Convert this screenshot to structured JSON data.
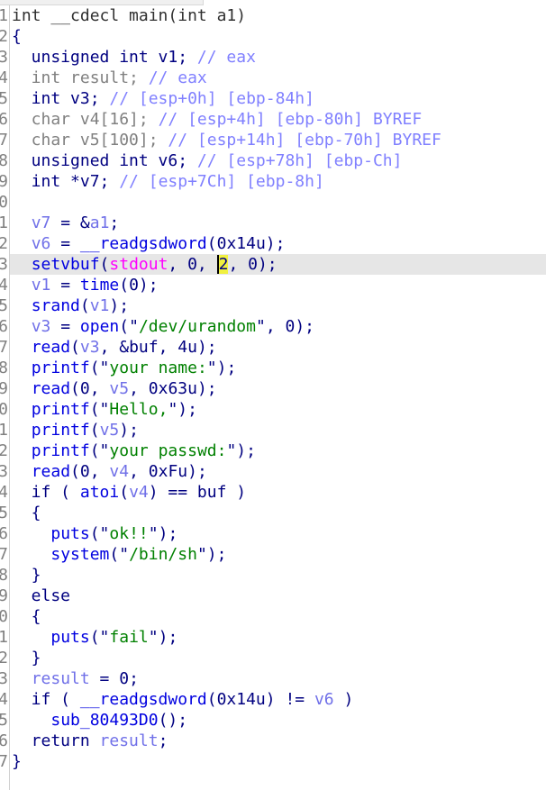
{
  "editor": {
    "view": "pseudocode",
    "current_line": 13,
    "colors": {
      "keyword": "#000080",
      "function": "#0000e0",
      "local_var": "#7070e8",
      "comment": "#8080ff",
      "unused": "#808080",
      "import": "#ff00ff",
      "string": "#008000",
      "highlight": "#f0f040"
    },
    "lines": [
      [
        [
          "hd",
          "int __cdecl main(int a1)"
        ]
      ],
      [
        [
          "kw",
          "{"
        ]
      ],
      [
        [
          "kw",
          "  unsigned int v1; "
        ],
        [
          "cm",
          "// eax"
        ]
      ],
      [
        [
          "un",
          "  int result; "
        ],
        [
          "cm",
          "// eax"
        ]
      ],
      [
        [
          "kw",
          "  int v3; "
        ],
        [
          "cm",
          "// [esp+0h] [ebp-84h]"
        ]
      ],
      [
        [
          "un",
          "  char v4[16]; "
        ],
        [
          "cm",
          "// [esp+4h] [ebp-80h] BYREF"
        ]
      ],
      [
        [
          "un",
          "  char v5[100]; "
        ],
        [
          "cm",
          "// [esp+14h] [ebp-70h] BYREF"
        ]
      ],
      [
        [
          "kw",
          "  unsigned int v6; "
        ],
        [
          "cm",
          "// [esp+78h] [ebp-Ch]"
        ]
      ],
      [
        [
          "kw",
          "  int *v7; "
        ],
        [
          "cm",
          "// [esp+7Ch] [ebp-8h]"
        ]
      ],
      [],
      [
        [
          "kw",
          "  "
        ],
        [
          "lv",
          "v7"
        ],
        [
          "kw",
          " = &"
        ],
        [
          "lv",
          "a1"
        ],
        [
          "kw",
          ";"
        ]
      ],
      [
        [
          "kw",
          "  "
        ],
        [
          "lv",
          "v6"
        ],
        [
          "kw",
          " = "
        ],
        [
          "fn",
          "__readgsdword"
        ],
        [
          "kw",
          "(0x14u);"
        ]
      ],
      [
        [
          "kw",
          "  "
        ],
        [
          "fn",
          "setvbuf"
        ],
        [
          "kw",
          "("
        ],
        [
          "mg",
          "stdout"
        ],
        [
          "kw",
          ", 0, "
        ],
        [
          "hl",
          "2"
        ],
        [
          "kw",
          ", 0);"
        ]
      ],
      [
        [
          "kw",
          "  "
        ],
        [
          "lv",
          "v1"
        ],
        [
          "kw",
          " = "
        ],
        [
          "fn",
          "time"
        ],
        [
          "kw",
          "(0);"
        ]
      ],
      [
        [
          "kw",
          "  "
        ],
        [
          "fn",
          "srand"
        ],
        [
          "kw",
          "("
        ],
        [
          "lv",
          "v1"
        ],
        [
          "kw",
          ");"
        ]
      ],
      [
        [
          "kw",
          "  "
        ],
        [
          "lv",
          "v3"
        ],
        [
          "kw",
          " = "
        ],
        [
          "fn",
          "open"
        ],
        [
          "kw",
          "(\""
        ],
        [
          "st",
          "/dev/urandom"
        ],
        [
          "kw",
          "\", 0);"
        ]
      ],
      [
        [
          "kw",
          "  "
        ],
        [
          "fn",
          "read"
        ],
        [
          "kw",
          "("
        ],
        [
          "lv",
          "v3"
        ],
        [
          "kw",
          ", &buf, 4u);"
        ]
      ],
      [
        [
          "kw",
          "  "
        ],
        [
          "fn",
          "printf"
        ],
        [
          "kw",
          "(\""
        ],
        [
          "st",
          "your name:"
        ],
        [
          "kw",
          "\");"
        ]
      ],
      [
        [
          "kw",
          "  "
        ],
        [
          "fn",
          "read"
        ],
        [
          "kw",
          "(0, "
        ],
        [
          "lv",
          "v5"
        ],
        [
          "kw",
          ", 0x63u);"
        ]
      ],
      [
        [
          "kw",
          "  "
        ],
        [
          "fn",
          "printf"
        ],
        [
          "kw",
          "(\""
        ],
        [
          "st",
          "Hello,"
        ],
        [
          "kw",
          "\");"
        ]
      ],
      [
        [
          "kw",
          "  "
        ],
        [
          "fn",
          "printf"
        ],
        [
          "kw",
          "("
        ],
        [
          "lv",
          "v5"
        ],
        [
          "kw",
          ");"
        ]
      ],
      [
        [
          "kw",
          "  "
        ],
        [
          "fn",
          "printf"
        ],
        [
          "kw",
          "(\""
        ],
        [
          "st",
          "your passwd:"
        ],
        [
          "kw",
          "\");"
        ]
      ],
      [
        [
          "kw",
          "  "
        ],
        [
          "fn",
          "read"
        ],
        [
          "kw",
          "(0, "
        ],
        [
          "lv",
          "v4"
        ],
        [
          "kw",
          ", 0xFu);"
        ]
      ],
      [
        [
          "kw",
          "  if ( "
        ],
        [
          "fn",
          "atoi"
        ],
        [
          "kw",
          "("
        ],
        [
          "lv",
          "v4"
        ],
        [
          "kw",
          ") == buf )"
        ]
      ],
      [
        [
          "kw",
          "  {"
        ]
      ],
      [
        [
          "kw",
          "    "
        ],
        [
          "fn",
          "puts"
        ],
        [
          "kw",
          "(\""
        ],
        [
          "st",
          "ok!!"
        ],
        [
          "kw",
          "\");"
        ]
      ],
      [
        [
          "kw",
          "    "
        ],
        [
          "fn",
          "system"
        ],
        [
          "kw",
          "(\""
        ],
        [
          "st",
          "/bin/sh"
        ],
        [
          "kw",
          "\");"
        ]
      ],
      [
        [
          "kw",
          "  }"
        ]
      ],
      [
        [
          "kw",
          "  else"
        ]
      ],
      [
        [
          "kw",
          "  {"
        ]
      ],
      [
        [
          "kw",
          "    "
        ],
        [
          "fn",
          "puts"
        ],
        [
          "kw",
          "(\""
        ],
        [
          "st",
          "fail"
        ],
        [
          "kw",
          "\");"
        ]
      ],
      [
        [
          "kw",
          "  }"
        ]
      ],
      [
        [
          "kw",
          "  "
        ],
        [
          "lv",
          "result"
        ],
        [
          "kw",
          " = 0;"
        ]
      ],
      [
        [
          "kw",
          "  if ( "
        ],
        [
          "fn",
          "__readgsdword"
        ],
        [
          "kw",
          "(0x14u) != "
        ],
        [
          "lv",
          "v6"
        ],
        [
          "kw",
          " )"
        ]
      ],
      [
        [
          "kw",
          "    "
        ],
        [
          "fn",
          "sub_80493D0"
        ],
        [
          "kw",
          "();"
        ]
      ],
      [
        [
          "kw",
          "  return "
        ],
        [
          "lv",
          "result"
        ],
        [
          "kw",
          ";"
        ]
      ],
      [
        [
          "kw",
          "}"
        ]
      ]
    ]
  }
}
